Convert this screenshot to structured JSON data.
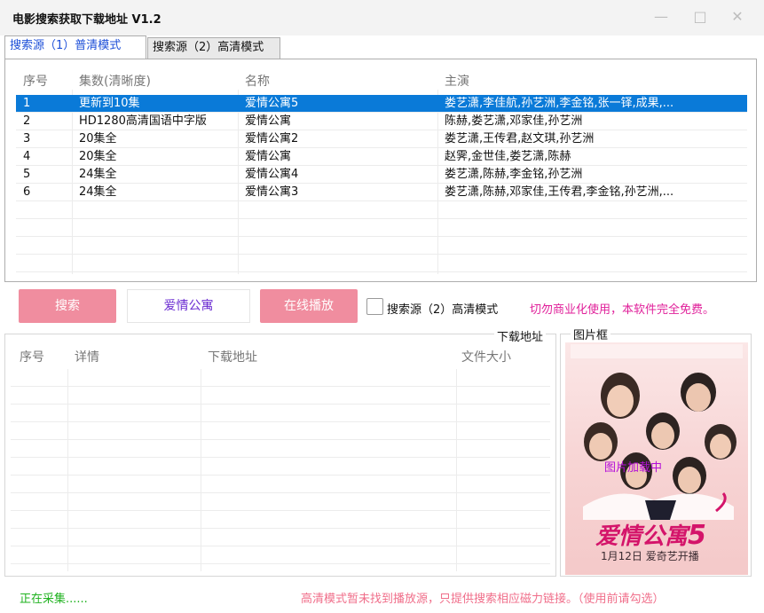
{
  "window": {
    "title": "电影搜索获取下载地址 V1.2",
    "min_icon": "minimize-icon",
    "max_icon": "maximize-icon",
    "close_icon": "close-icon"
  },
  "tabs": [
    {
      "label": "搜索源（1）普清模式",
      "active": true
    },
    {
      "label": "搜索源（2）高清模式",
      "active": false
    }
  ],
  "results_table": {
    "headers": [
      "序号",
      "集数(清晰度)",
      "名称",
      "主演"
    ],
    "rows": [
      [
        "1",
        "更新到10集",
        "爱情公寓5",
        "娄艺潇,李佳航,孙艺洲,李金铭,张一铎,成果,..."
      ],
      [
        "2",
        "HD1280高清国语中字版",
        "爱情公寓",
        "陈赫,娄艺潇,邓家佳,孙艺洲"
      ],
      [
        "3",
        "20集全",
        "爱情公寓2",
        "娄艺潇,王传君,赵文琪,孙艺洲"
      ],
      [
        "4",
        "20集全",
        "爱情公寓",
        "赵霁,金世佳,娄艺潇,陈赫"
      ],
      [
        "5",
        "24集全",
        "爱情公寓4",
        "娄艺潇,陈赫,李金铭,孙艺洲"
      ],
      [
        "6",
        "24集全",
        "爱情公寓3",
        "娄艺潇,陈赫,邓家佳,王传君,李金铭,孙艺洲,..."
      ]
    ],
    "selected_row": 0
  },
  "controls": {
    "search_button": "搜索",
    "search_value": "爱情公寓",
    "play_button": "在线播放",
    "checkbox_label": "搜索源（2）高清模式",
    "checkbox_checked": false,
    "notice": "切勿商业化使用，本软件完全免费。"
  },
  "download_group": {
    "label": "下载地址",
    "headers": [
      "序号",
      "详情",
      "下载地址",
      "文件大小"
    ]
  },
  "picture_group": {
    "label": "图片框",
    "overlay_text": "图片加载中",
    "poster_title": "爱情公寓",
    "poster_number": "5",
    "poster_date": "1月12日  爱奇艺开播"
  },
  "status": {
    "left": "正在采集......",
    "right": "高清模式暂未找到播放源，只提供搜索相应磁力链接。（使用前请勾选）"
  },
  "colors": {
    "accent_blue": "#0a7ad8",
    "button_pink": "#f08d9f",
    "notice_magenta": "#e0209a",
    "status_green": "#1fb21f",
    "status_pink": "#f06e8a"
  }
}
